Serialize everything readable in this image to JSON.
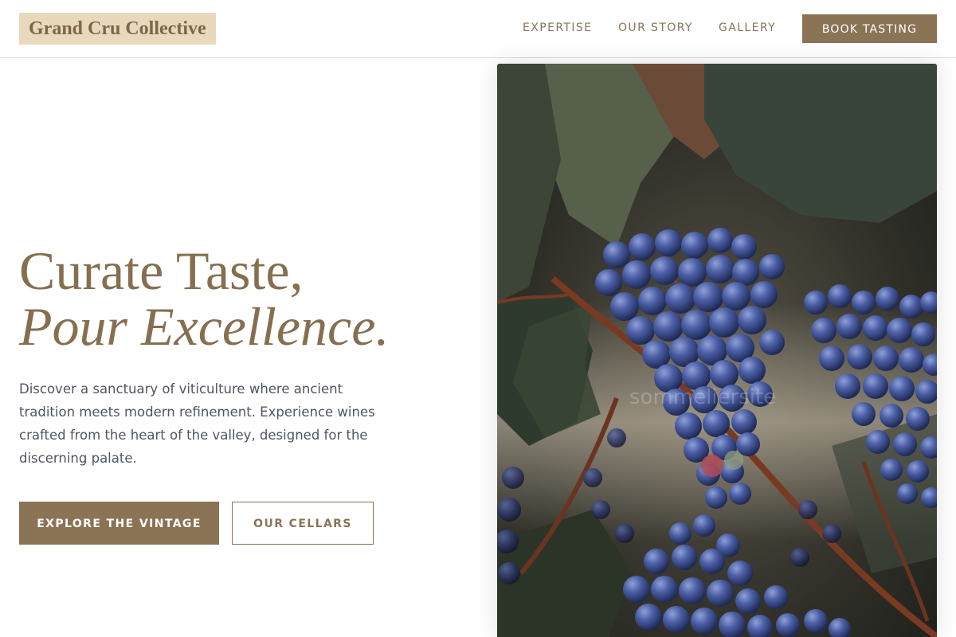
{
  "header": {
    "logo": "Grand Cru Collective",
    "nav": [
      {
        "label": "EXPERTISE"
      },
      {
        "label": "OUR STORY"
      },
      {
        "label": "GALLERY"
      }
    ],
    "cta_label": "BOOK TASTING"
  },
  "hero": {
    "headline_line1": "Curate Taste,",
    "headline_line2": "Pour Excellence.",
    "description": "Discover a sanctuary of viticulture where ancient tradition meets modern refinement. Experience wines crafted from the heart of the valley, designed for the discerning palate.",
    "primary_button": "EXPLORE THE VINTAGE",
    "secondary_button": "OUR CELLARS",
    "image_watermark": "sommeliersite"
  },
  "colors": {
    "accent": "#8b7355",
    "logo_background": "#e8d8bc",
    "heading": "#866f50",
    "body_text": "#4e5661"
  }
}
